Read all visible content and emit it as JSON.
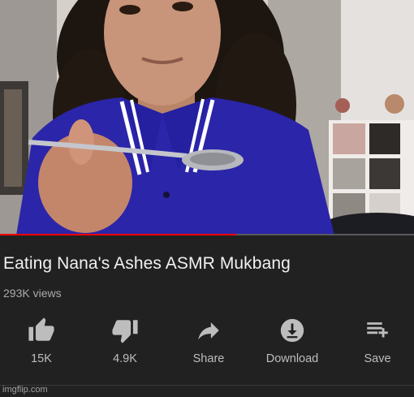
{
  "video": {
    "title": "Eating Nana's Ashes ASMR Mukbang",
    "views": "293K views",
    "progress": 0.57
  },
  "actions": [
    {
      "label": "15K",
      "icon": "thumbs-up-icon"
    },
    {
      "label": "4.9K",
      "icon": "thumbs-down-icon"
    },
    {
      "label": "Share",
      "icon": "share-icon"
    },
    {
      "label": "Download",
      "icon": "download-icon"
    },
    {
      "label": "Save",
      "icon": "playlist-add-icon"
    }
  ],
  "watermark": "imgflip.com",
  "colors": {
    "background": "#212121",
    "progress": "#ff0000",
    "title_text": "#f1f1f1",
    "secondary_text": "#aaaaaa"
  }
}
